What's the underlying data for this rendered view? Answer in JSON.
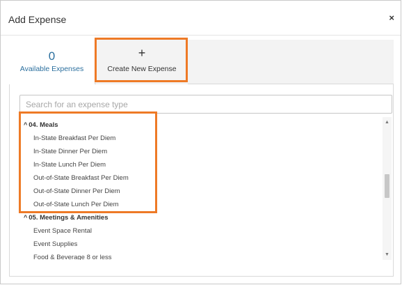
{
  "dialog": {
    "title": "Add Expense",
    "close_glyph": "×"
  },
  "tabs": {
    "available": {
      "count": "0",
      "label": "Available Expenses"
    },
    "create": {
      "plus_glyph": "+",
      "label": "Create New Expense"
    }
  },
  "search": {
    "placeholder": "Search for an expense type",
    "value": ""
  },
  "groups": [
    {
      "label": "04. Meals",
      "items": [
        "In-State Breakfast Per Diem",
        "In-State Dinner Per Diem",
        "In-State Lunch Per Diem",
        "Out-of-State Breakfast Per Diem",
        "Out-of-State Dinner Per Diem",
        "Out-of-State Lunch Per Diem"
      ]
    },
    {
      "label": "05. Meetings & Amenities",
      "items": [
        "Event Space Rental",
        "Event Supplies",
        "Food & Beverage 8 or less"
      ]
    }
  ],
  "icons": {
    "caret": "^",
    "scroll_up": "▲",
    "scroll_down": "▼"
  },
  "colors": {
    "accent_link": "#2b6f9e",
    "highlight": "#ee7a26"
  }
}
